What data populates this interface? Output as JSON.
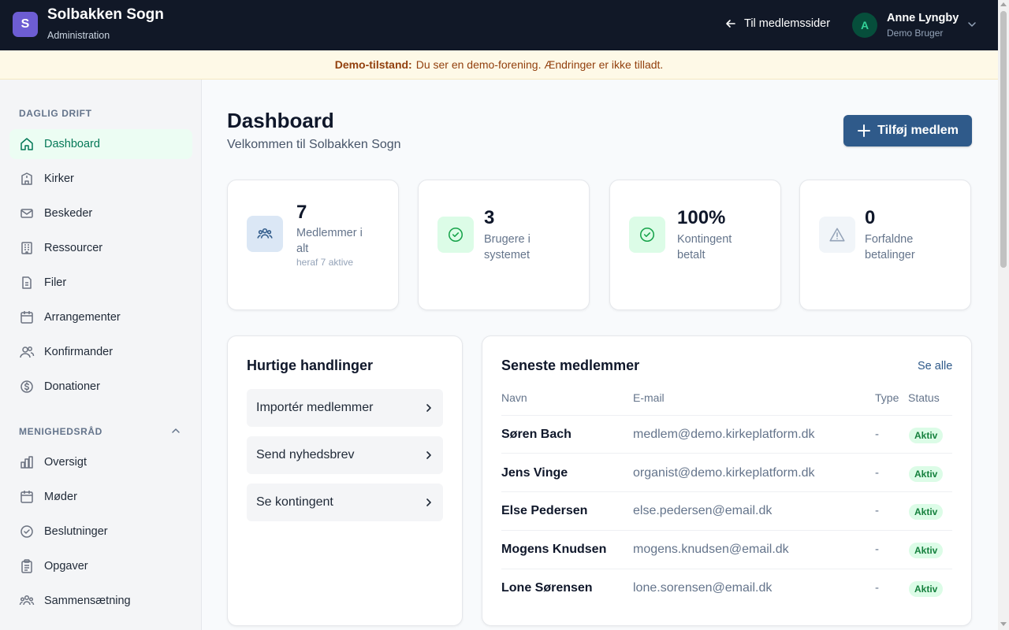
{
  "header": {
    "logo_letter": "S",
    "title": "Solbakken Sogn",
    "subtitle": "Administration",
    "back_link": "Til medlemssider",
    "user": {
      "initial": "A",
      "name": "Anne Lyngby",
      "role": "Demo Bruger"
    }
  },
  "banner": {
    "label": "Demo-tilstand:",
    "text": "Du ser en demo-forening. Ændringer er ikke tilladt."
  },
  "sidebar": {
    "section1": "DAGLIG DRIFT",
    "items1": [
      {
        "label": "Dashboard",
        "icon": "home-icon",
        "active": true
      },
      {
        "label": "Kirker",
        "icon": "church-icon"
      },
      {
        "label": "Beskeder",
        "icon": "mail-icon"
      },
      {
        "label": "Ressourcer",
        "icon": "building-icon"
      },
      {
        "label": "Filer",
        "icon": "file-icon"
      },
      {
        "label": "Arrangementer",
        "icon": "calendar-icon"
      },
      {
        "label": "Konfirmander",
        "icon": "users-icon"
      },
      {
        "label": "Donationer",
        "icon": "dollar-icon"
      }
    ],
    "section2": "MENIGHEDSRÅD",
    "items2": [
      {
        "label": "Oversigt",
        "icon": "bar-chart-icon"
      },
      {
        "label": "Møder",
        "icon": "calendar-icon"
      },
      {
        "label": "Beslutninger",
        "icon": "check-circle-icon"
      },
      {
        "label": "Opgaver",
        "icon": "clipboard-icon"
      },
      {
        "label": "Sammensætning",
        "icon": "group-icon"
      }
    ]
  },
  "main": {
    "title": "Dashboard",
    "subtitle": "Velkommen til Solbakken Sogn",
    "add_button": "Tilføj medlem",
    "stats": [
      {
        "value": "7",
        "label": "Medlemmer i alt",
        "note": "heraf 7 aktive",
        "icon": "users-icon",
        "color": "#dbe7f5"
      },
      {
        "value": "3",
        "label": "Brugere i systemet",
        "icon": "check-circle-icon",
        "color": "#dcfce7"
      },
      {
        "value": "100%",
        "label": "Kontingent betalt",
        "icon": "check-circle-icon",
        "color": "#dcfce7"
      },
      {
        "value": "0",
        "label": "Forfaldne betalinger",
        "icon": "warning-icon",
        "color": "#f1f5f9"
      }
    ],
    "quick_actions": {
      "title": "Hurtige handlinger",
      "items": [
        "Importér medlemmer",
        "Send nyhedsbrev",
        "Se kontingent"
      ]
    },
    "recent_members": {
      "title": "Seneste medlemmer",
      "see_all": "Se alle",
      "columns": [
        "Navn",
        "E-mail",
        "Type",
        "Status"
      ],
      "rows": [
        {
          "name": "Søren Bach",
          "email": "medlem@demo.kirkeplatform.dk",
          "type": "-",
          "status": "Aktiv"
        },
        {
          "name": "Jens Vinge",
          "email": "organist@demo.kirkeplatform.dk",
          "type": "-",
          "status": "Aktiv"
        },
        {
          "name": "Else Pedersen",
          "email": "else.pedersen@email.dk",
          "type": "-",
          "status": "Aktiv"
        },
        {
          "name": "Mogens Knudsen",
          "email": "mogens.knudsen@email.dk",
          "type": "-",
          "status": "Aktiv"
        },
        {
          "name": "Lone Sørensen",
          "email": "lone.sorensen@email.dk",
          "type": "-",
          "status": "Aktiv"
        }
      ]
    }
  }
}
